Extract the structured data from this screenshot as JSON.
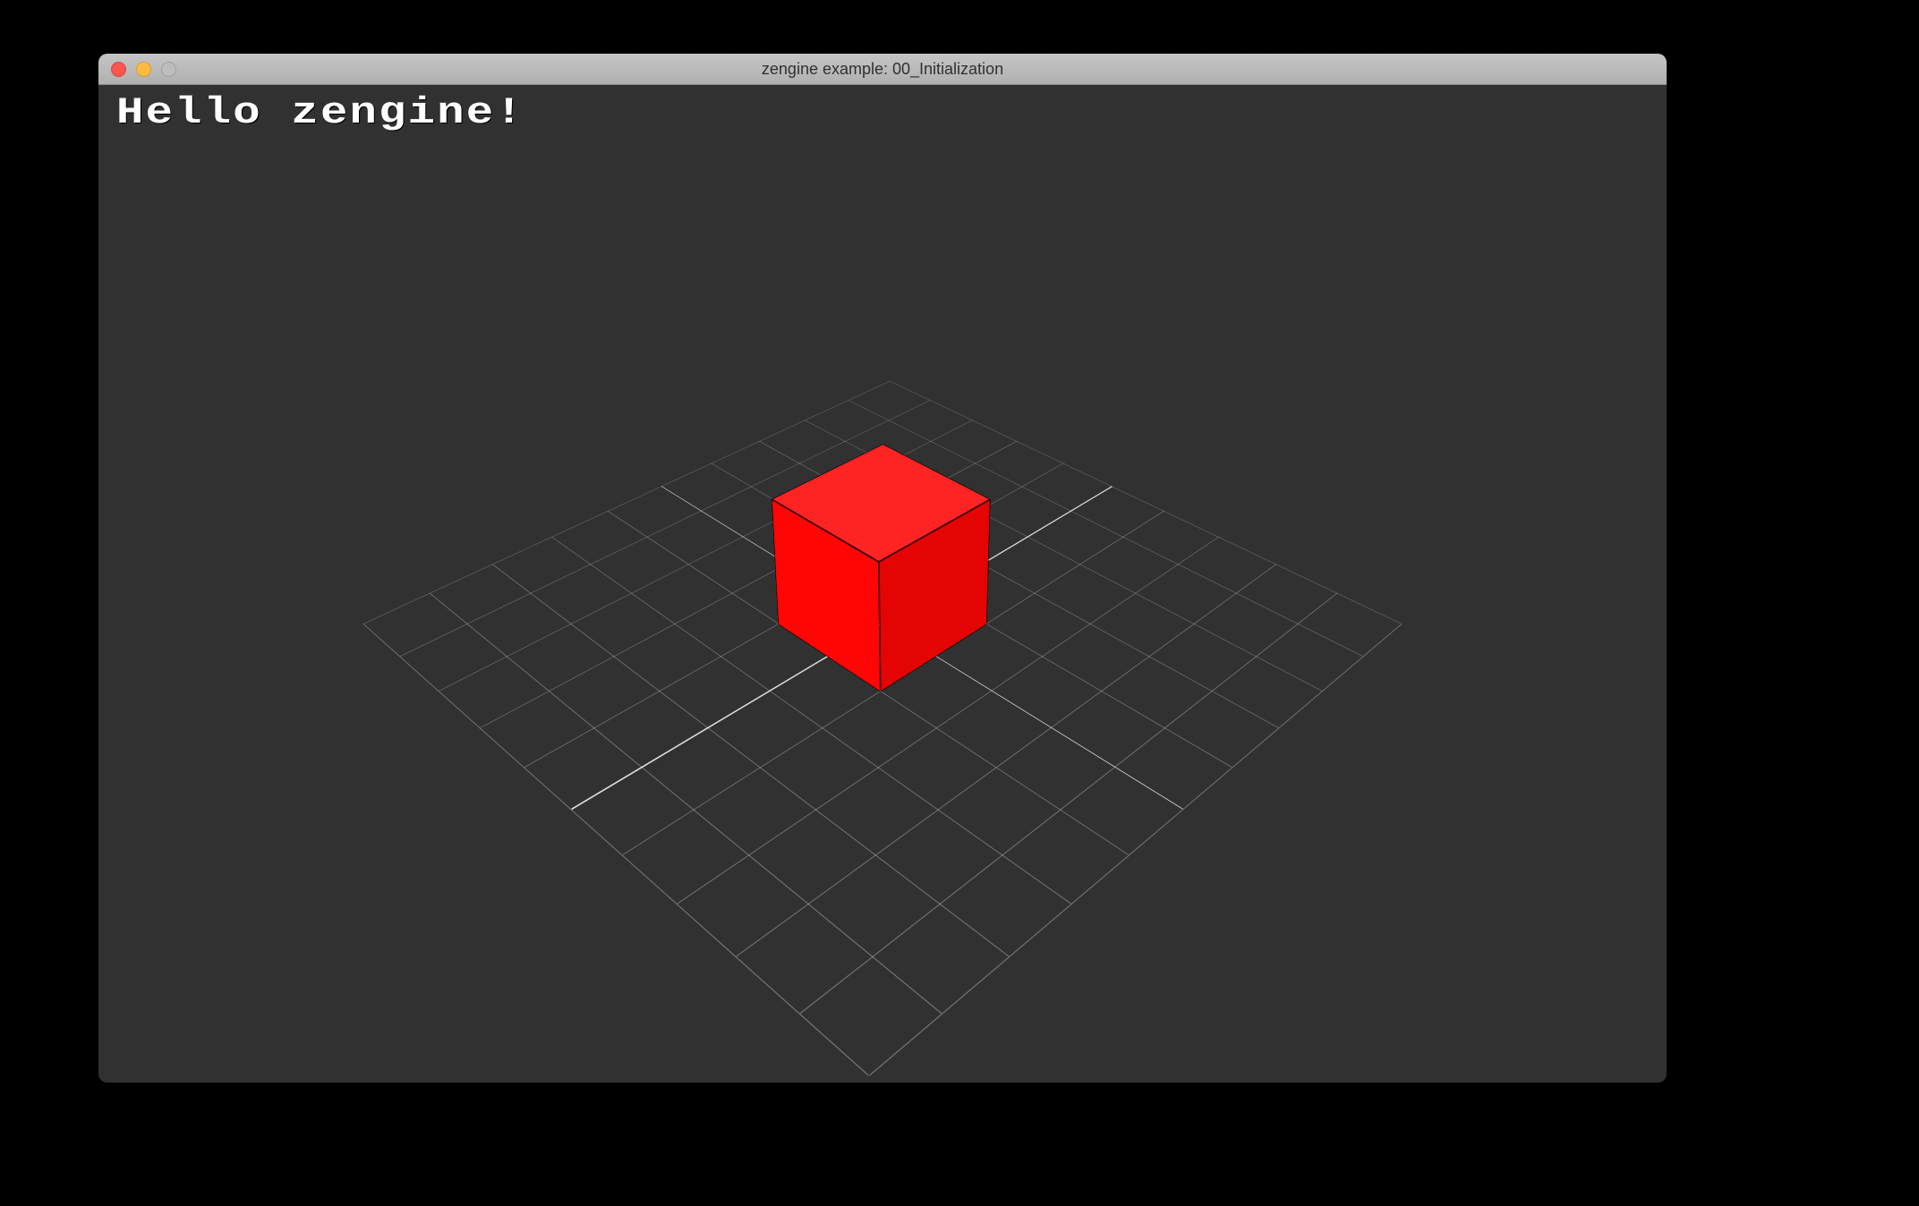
{
  "window": {
    "title": "zengine example: 00_Initialization",
    "traffic_lights": [
      "close",
      "minimize",
      "maximize"
    ]
  },
  "overlay": {
    "greeting": "Hello zengine!"
  },
  "scene": {
    "background": "#313131",
    "grid": {
      "extent": 5,
      "cell_size": 1,
      "axis_color": "#ffffff",
      "line_color": "rgba(255,255,255,0.35)"
    },
    "objects": [
      {
        "type": "cube",
        "position": [
          0,
          0,
          0
        ],
        "size": 1,
        "color": "#ff0000",
        "wireframe_edges": true
      }
    ],
    "camera": {
      "kind": "perspective",
      "rough_orbit": "isometric"
    }
  },
  "colors": {
    "cube": "#ff0505",
    "grid_axis": "#ffffff",
    "viewport_bg": "#313131"
  }
}
